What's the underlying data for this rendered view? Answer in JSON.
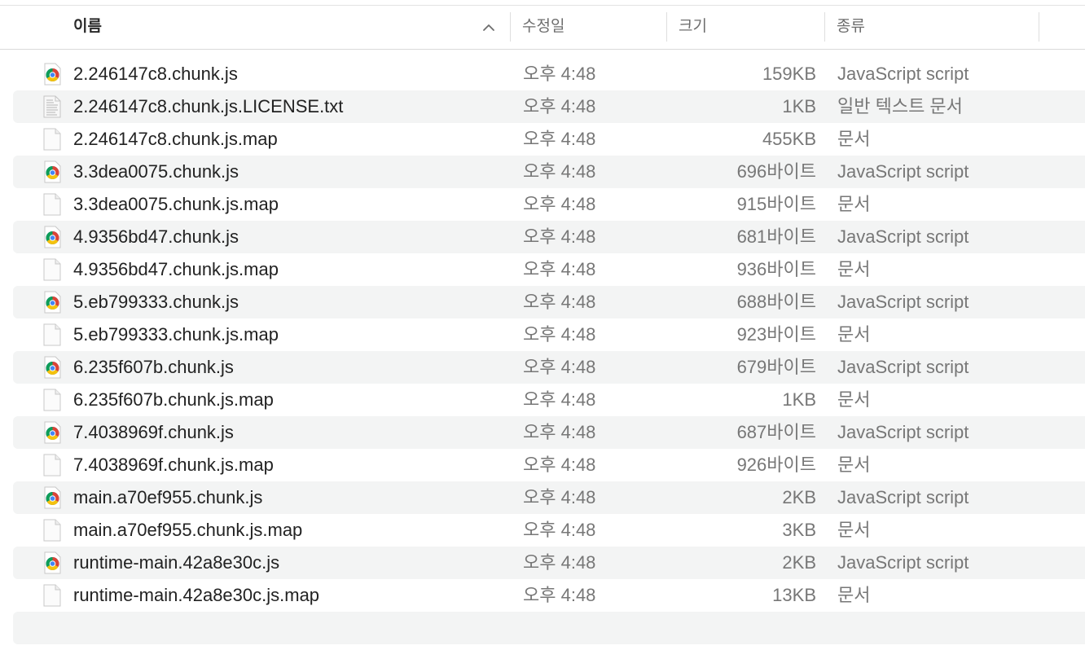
{
  "header": {
    "name_label": "이름",
    "date_label": "수정일",
    "size_label": "크기",
    "kind_label": "종류"
  },
  "colors": {
    "header_text": "#6d6d6d",
    "row_alt_bg": "#f3f4f4",
    "meta_text": "#777777",
    "chrome_red": "#db4437",
    "chrome_yellow": "#f4c20d",
    "chrome_green": "#0f9d58",
    "chrome_blue": "#4285f4"
  },
  "files": [
    {
      "name": "2.246147c8.chunk.js",
      "date": "오후 4:48",
      "size": "159KB",
      "kind": "JavaScript script",
      "icon": "chrome-icon"
    },
    {
      "name": "2.246147c8.chunk.js.LICENSE.txt",
      "date": "오후 4:48",
      "size": "1KB",
      "kind": "일반 텍스트 문서",
      "icon": "text-document-icon"
    },
    {
      "name": "2.246147c8.chunk.js.map",
      "date": "오후 4:48",
      "size": "455KB",
      "kind": "문서",
      "icon": "blank-document-icon"
    },
    {
      "name": "3.3dea0075.chunk.js",
      "date": "오후 4:48",
      "size": "696바이트",
      "kind": "JavaScript script",
      "icon": "chrome-icon"
    },
    {
      "name": "3.3dea0075.chunk.js.map",
      "date": "오후 4:48",
      "size": "915바이트",
      "kind": "문서",
      "icon": "blank-document-icon"
    },
    {
      "name": "4.9356bd47.chunk.js",
      "date": "오후 4:48",
      "size": "681바이트",
      "kind": "JavaScript script",
      "icon": "chrome-icon"
    },
    {
      "name": "4.9356bd47.chunk.js.map",
      "date": "오후 4:48",
      "size": "936바이트",
      "kind": "문서",
      "icon": "blank-document-icon"
    },
    {
      "name": "5.eb799333.chunk.js",
      "date": "오후 4:48",
      "size": "688바이트",
      "kind": "JavaScript script",
      "icon": "chrome-icon"
    },
    {
      "name": "5.eb799333.chunk.js.map",
      "date": "오후 4:48",
      "size": "923바이트",
      "kind": "문서",
      "icon": "blank-document-icon"
    },
    {
      "name": "6.235f607b.chunk.js",
      "date": "오후 4:48",
      "size": "679바이트",
      "kind": "JavaScript script",
      "icon": "chrome-icon"
    },
    {
      "name": "6.235f607b.chunk.js.map",
      "date": "오후 4:48",
      "size": "1KB",
      "kind": "문서",
      "icon": "blank-document-icon"
    },
    {
      "name": "7.4038969f.chunk.js",
      "date": "오후 4:48",
      "size": "687바이트",
      "kind": "JavaScript script",
      "icon": "chrome-icon"
    },
    {
      "name": "7.4038969f.chunk.js.map",
      "date": "오후 4:48",
      "size": "926바이트",
      "kind": "문서",
      "icon": "blank-document-icon"
    },
    {
      "name": "main.a70ef955.chunk.js",
      "date": "오후 4:48",
      "size": "2KB",
      "kind": "JavaScript script",
      "icon": "chrome-icon"
    },
    {
      "name": "main.a70ef955.chunk.js.map",
      "date": "오후 4:48",
      "size": "3KB",
      "kind": "문서",
      "icon": "blank-document-icon"
    },
    {
      "name": "runtime-main.42a8e30c.js",
      "date": "오후 4:48",
      "size": "2KB",
      "kind": "JavaScript script",
      "icon": "chrome-icon"
    },
    {
      "name": "runtime-main.42a8e30c.js.map",
      "date": "오후 4:48",
      "size": "13KB",
      "kind": "문서",
      "icon": "blank-document-icon"
    }
  ]
}
